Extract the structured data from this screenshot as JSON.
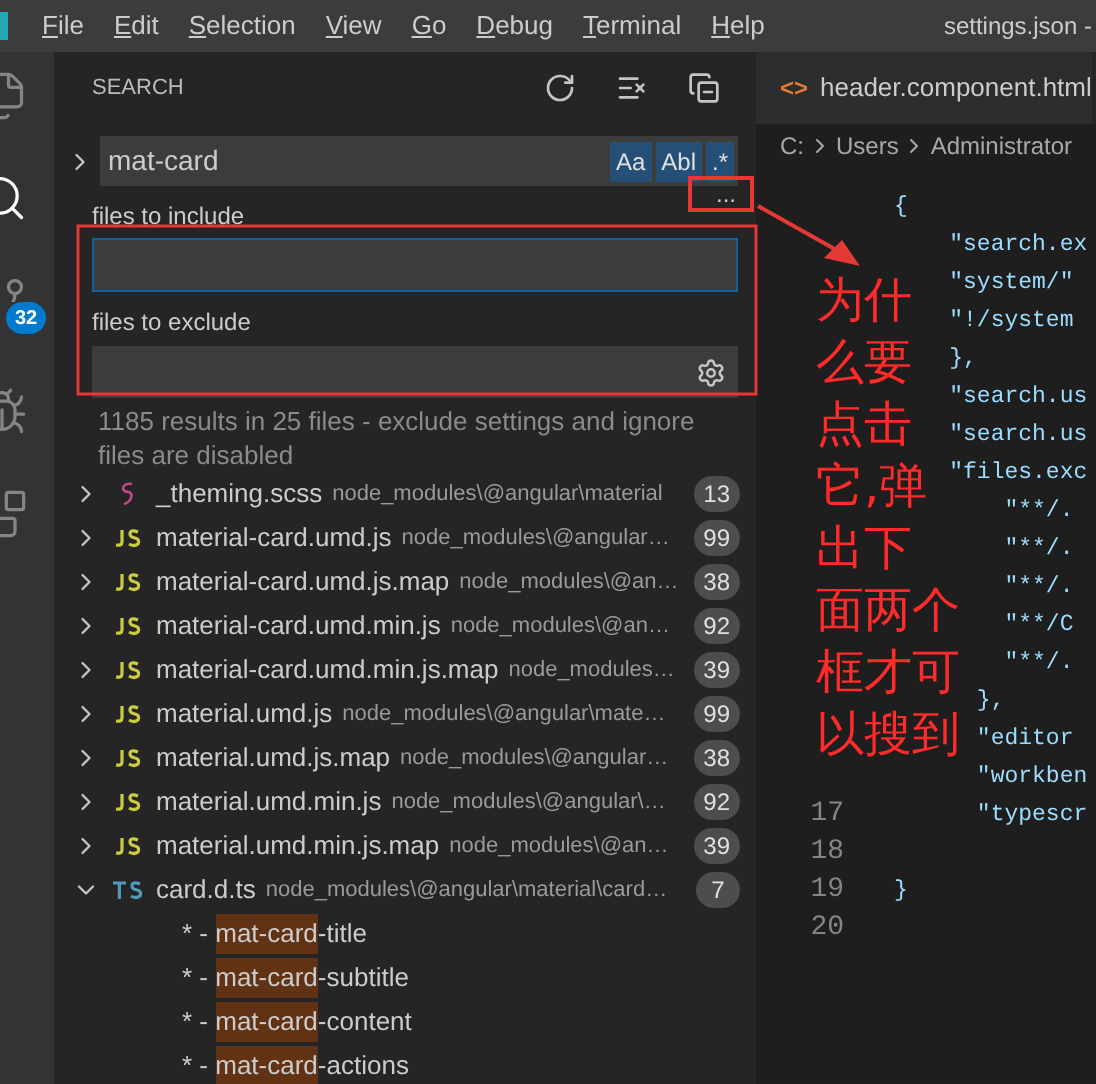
{
  "menu_bar": {
    "items": [
      "File",
      "Edit",
      "Selection",
      "View",
      "Go",
      "Debug",
      "Terminal",
      "Help"
    ],
    "title": "settings.json -"
  },
  "activity_bar": {
    "badge": "32"
  },
  "search_panel": {
    "title": "SEARCH",
    "query": "mat-card",
    "toggles": [
      {
        "label": "Aa",
        "on": true
      },
      {
        "label": "Abl",
        "on": true
      },
      {
        "label": ".*",
        "on": true
      }
    ],
    "more": "...",
    "include_label": "files to include",
    "exclude_label": "files to exclude",
    "message": "1185 results in 25 files - exclude settings and ignore files are disabled",
    "results": [
      {
        "kind": "scss",
        "name": "_theming.scss",
        "path": "node_modules\\@angular\\material",
        "count": "13",
        "expanded": false
      },
      {
        "kind": "js",
        "name": "material-card.umd.js",
        "path": "node_modules\\@angular…",
        "count": "99",
        "expanded": false
      },
      {
        "kind": "js",
        "name": "material-card.umd.js.map",
        "path": "node_modules\\@an…",
        "count": "38",
        "expanded": false
      },
      {
        "kind": "js",
        "name": "material-card.umd.min.js",
        "path": "node_modules\\@an…",
        "count": "92",
        "expanded": false
      },
      {
        "kind": "js",
        "name": "material-card.umd.min.js.map",
        "path": "node_modules…",
        "count": "39",
        "expanded": false
      },
      {
        "kind": "js",
        "name": "material.umd.js",
        "path": "node_modules\\@angular\\mate…",
        "count": "99",
        "expanded": false
      },
      {
        "kind": "js",
        "name": "material.umd.js.map",
        "path": "node_modules\\@angular…",
        "count": "38",
        "expanded": false
      },
      {
        "kind": "js",
        "name": "material.umd.min.js",
        "path": "node_modules\\@angular\\…",
        "count": "92",
        "expanded": false
      },
      {
        "kind": "js",
        "name": "material.umd.min.js.map",
        "path": "node_modules\\@an…",
        "count": "39",
        "expanded": false
      },
      {
        "kind": "ts",
        "name": "card.d.ts",
        "path": "node_modules\\@angular\\material\\card…",
        "count": "7",
        "expanded": true,
        "matches": [
          {
            "prefix": "* - ",
            "match": "mat-card",
            "suffix": "-title"
          },
          {
            "prefix": "* - ",
            "match": "mat-card",
            "suffix": "-subtitle"
          },
          {
            "prefix": "* - ",
            "match": "mat-card",
            "suffix": "-content"
          },
          {
            "prefix": "* - ",
            "match": "mat-card",
            "suffix": "-actions"
          }
        ]
      }
    ]
  },
  "editor": {
    "tab": "header.component.html",
    "tab_icon": "<>",
    "breadcrumb": [
      "C:",
      "Users",
      "Administrator"
    ],
    "lines": [
      {
        "text": "{"
      },
      {
        "text": "    \"search.ex"
      },
      {
        "text": "    \"system/\""
      },
      {
        "text": "    \"!/system"
      },
      {
        "text": "    },"
      },
      {
        "text": "    \"search.us"
      },
      {
        "text": "    \"search.us"
      },
      {
        "text": "    \"files.exc"
      },
      {
        "text": "        \"**/."
      },
      {
        "text": "        \"**/."
      },
      {
        "text": "        \"**/."
      },
      {
        "text": "        \"**/C"
      },
      {
        "text": "        \"**/."
      },
      {
        "text": "      },"
      },
      {
        "text": "      \"editor"
      },
      {
        "text": "      \"workben"
      },
      {
        "number": "17",
        "text": "      \"typescr"
      },
      {
        "number": "18"
      },
      {
        "number": "19",
        "text": "}"
      },
      {
        "number": "20"
      }
    ]
  },
  "annotation": {
    "lines": [
      "为什",
      "么要",
      "点击",
      "它,弹",
      "出下",
      "面两个",
      "框才可",
      "以搜到"
    ]
  }
}
